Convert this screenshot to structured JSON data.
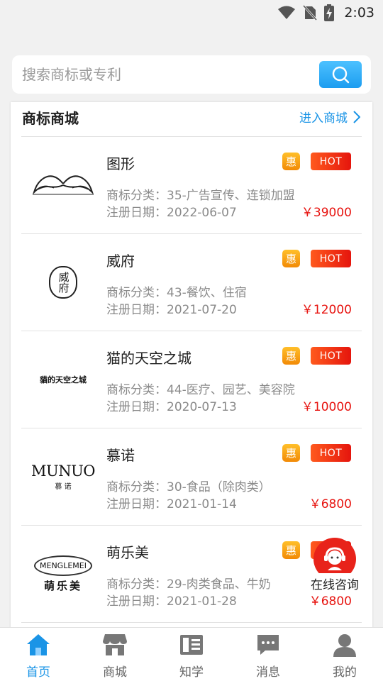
{
  "status_bar": {
    "time": "2:03"
  },
  "search": {
    "placeholder": "搜索商标或专利"
  },
  "section": {
    "title": "商标商城",
    "more_label": "进入商城"
  },
  "badges": {
    "discount": "惠",
    "hot": "HOT"
  },
  "items": [
    {
      "name": "图形",
      "category": "商标分类：35-广告宣传、连锁加盟",
      "date": "注册日期：2022-06-07",
      "price": "￥39000",
      "logo_text": ""
    },
    {
      "name": "威府",
      "category": "商标分类：43-餐饮、住宿",
      "date": "注册日期：2021-07-20",
      "price": "￥12000",
      "logo_text": "威府"
    },
    {
      "name": "猫的天空之城",
      "category": "商标分类：44-医疗、园艺、美容院",
      "date": "注册日期：2020-07-13",
      "price": "￥10000",
      "logo_text": "貓的天空之城"
    },
    {
      "name": "慕诺",
      "category": "商标分类：30-食品（除肉类）",
      "date": "注册日期：2021-01-14",
      "price": "￥6800",
      "logo_text": "MUNUO",
      "logo_sub": "慕 诺"
    },
    {
      "name": "萌乐美",
      "category": "商标分类：29-肉类食品、牛奶",
      "date": "注册日期：2021-01-28",
      "price": "￥6800",
      "logo_text": "MENGLEMEI",
      "logo_sub": "萌乐美"
    }
  ],
  "consult": {
    "label": "在线咨询"
  },
  "tabs": [
    {
      "label": "首页",
      "icon": "home-icon",
      "active": true
    },
    {
      "label": "商城",
      "icon": "shop-icon",
      "active": false
    },
    {
      "label": "知学",
      "icon": "book-icon",
      "active": false
    },
    {
      "label": "消息",
      "icon": "message-icon",
      "active": false
    },
    {
      "label": "我的",
      "icon": "user-icon",
      "active": false
    }
  ],
  "colors": {
    "accent": "#1a94e6",
    "price": "#e7130f",
    "hot": "#e5150d",
    "discount": "#f5a00e"
  }
}
